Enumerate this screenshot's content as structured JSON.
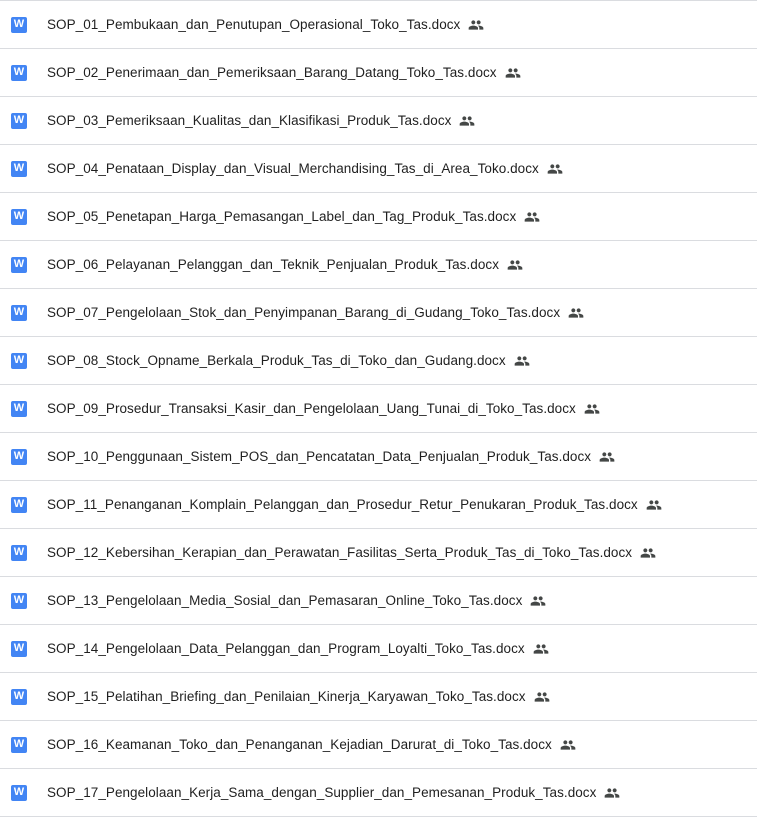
{
  "files": [
    {
      "name": "SOP_01_Pembukaan_dan_Penutupan_Operasional_Toko_Tas.docx",
      "type_icon": "word-doc-icon",
      "type_letter": "W",
      "shared_icon": "people-icon"
    },
    {
      "name": "SOP_02_Penerimaan_dan_Pemeriksaan_Barang_Datang_Toko_Tas.docx",
      "type_icon": "word-doc-icon",
      "type_letter": "W",
      "shared_icon": "people-icon"
    },
    {
      "name": "SOP_03_Pemeriksaan_Kualitas_dan_Klasifikasi_Produk_Tas.docx",
      "type_icon": "word-doc-icon",
      "type_letter": "W",
      "shared_icon": "people-icon"
    },
    {
      "name": "SOP_04_Penataan_Display_dan_Visual_Merchandising_Tas_di_Area_Toko.docx",
      "type_icon": "word-doc-icon",
      "type_letter": "W",
      "shared_icon": "people-icon"
    },
    {
      "name": "SOP_05_Penetapan_Harga_Pemasangan_Label_dan_Tag_Produk_Tas.docx",
      "type_icon": "word-doc-icon",
      "type_letter": "W",
      "shared_icon": "people-icon"
    },
    {
      "name": "SOP_06_Pelayanan_Pelanggan_dan_Teknik_Penjualan_Produk_Tas.docx",
      "type_icon": "word-doc-icon",
      "type_letter": "W",
      "shared_icon": "people-icon"
    },
    {
      "name": "SOP_07_Pengelolaan_Stok_dan_Penyimpanan_Barang_di_Gudang_Toko_Tas.docx",
      "type_icon": "word-doc-icon",
      "type_letter": "W",
      "shared_icon": "people-icon"
    },
    {
      "name": "SOP_08_Stock_Opname_Berkala_Produk_Tas_di_Toko_dan_Gudang.docx",
      "type_icon": "word-doc-icon",
      "type_letter": "W",
      "shared_icon": "people-icon"
    },
    {
      "name": "SOP_09_Prosedur_Transaksi_Kasir_dan_Pengelolaan_Uang_Tunai_di_Toko_Tas.docx",
      "type_icon": "word-doc-icon",
      "type_letter": "W",
      "shared_icon": "people-icon"
    },
    {
      "name": "SOP_10_Penggunaan_Sistem_POS_dan_Pencatatan_Data_Penjualan_Produk_Tas.docx",
      "type_icon": "word-doc-icon",
      "type_letter": "W",
      "shared_icon": "people-icon"
    },
    {
      "name": "SOP_11_Penanganan_Komplain_Pelanggan_dan_Prosedur_Retur_Penukaran_Produk_Tas.docx",
      "type_icon": "word-doc-icon",
      "type_letter": "W",
      "shared_icon": "people-icon"
    },
    {
      "name": "SOP_12_Kebersihan_Kerapian_dan_Perawatan_Fasilitas_Serta_Produk_Tas_di_Toko_Tas.docx",
      "type_icon": "word-doc-icon",
      "type_letter": "W",
      "shared_icon": "people-icon"
    },
    {
      "name": "SOP_13_Pengelolaan_Media_Sosial_dan_Pemasaran_Online_Toko_Tas.docx",
      "type_icon": "word-doc-icon",
      "type_letter": "W",
      "shared_icon": "people-icon"
    },
    {
      "name": "SOP_14_Pengelolaan_Data_Pelanggan_dan_Program_Loyalti_Toko_Tas.docx",
      "type_icon": "word-doc-icon",
      "type_letter": "W",
      "shared_icon": "people-icon"
    },
    {
      "name": "SOP_15_Pelatihan_Briefing_dan_Penilaian_Kinerja_Karyawan_Toko_Tas.docx",
      "type_icon": "word-doc-icon",
      "type_letter": "W",
      "shared_icon": "people-icon"
    },
    {
      "name": "SOP_16_Keamanan_Toko_dan_Penanganan_Kejadian_Darurat_di_Toko_Tas.docx",
      "type_icon": "word-doc-icon",
      "type_letter": "W",
      "shared_icon": "people-icon"
    },
    {
      "name": "SOP_17_Pengelolaan_Kerja_Sama_dengan_Supplier_dan_Pemesanan_Produk_Tas.docx",
      "type_icon": "word-doc-icon",
      "type_letter": "W",
      "shared_icon": "people-icon"
    }
  ],
  "colors": {
    "word_icon_bg": "#4285f4",
    "text": "#1f1f1f",
    "divider": "#dadce0",
    "shared_icon": "#444746"
  }
}
